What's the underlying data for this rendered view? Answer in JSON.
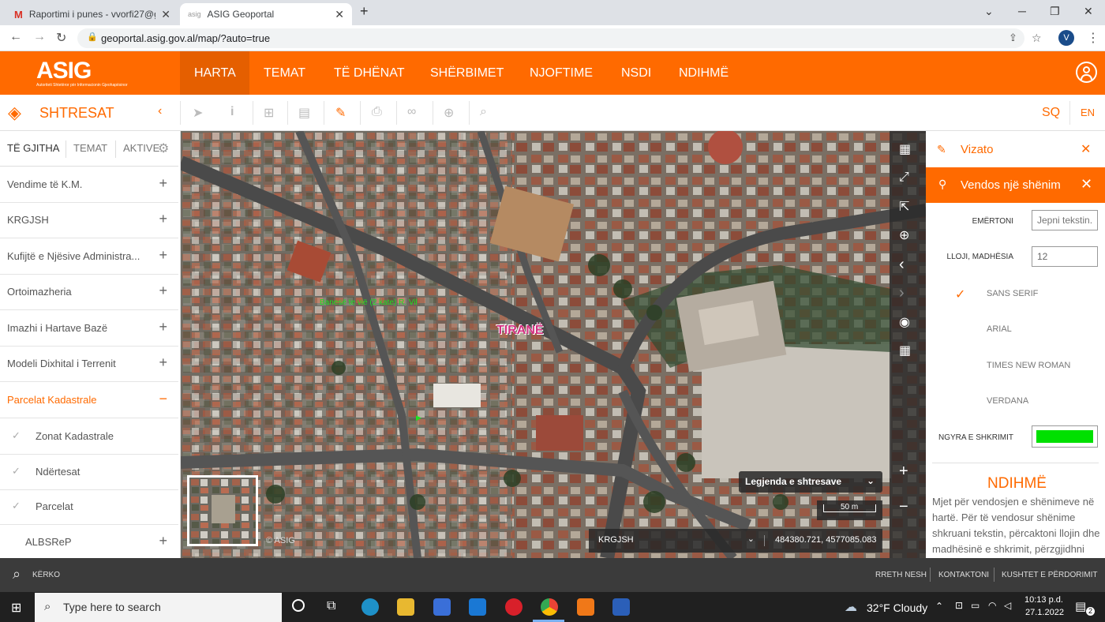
{
  "browser": {
    "tabs": [
      {
        "title": "Raportimi i punes - vvorfi27@gm",
        "active": false
      },
      {
        "title": "ASIG Geoportal",
        "active": true
      }
    ],
    "url": "geoportal.asig.gov.al/map/?auto=true",
    "profile_initial": "V"
  },
  "header": {
    "logo": "ASIG",
    "logo_tagline": "Autoriteti Shtetëror për Informacionin Gjeohapësinor",
    "nav": [
      "HARTA",
      "TEMAT",
      "TË DHËNAT",
      "SHËRBIMET",
      "NJOFTIME",
      "NSDI",
      "NDIHMË"
    ],
    "active_nav": "HARTA"
  },
  "toolbar": {
    "layers_title": "SHTRESAT",
    "languages": [
      "SQ",
      "EN"
    ]
  },
  "sidebar": {
    "tabs": [
      "TË GJITHA",
      "TEMAT",
      "AKTIVE"
    ],
    "items": [
      {
        "label": "Vendime të K.M.",
        "sign": "+"
      },
      {
        "label": "KRGJSH",
        "sign": "+"
      },
      {
        "label": "Kufijtë e Njësive Administra...",
        "sign": "+"
      },
      {
        "label": "Ortoimazheria",
        "sign": "+"
      },
      {
        "label": "Imazhi i Hartave Bazë",
        "sign": "+"
      },
      {
        "label": "Modeli Dixhital i Terrenit",
        "sign": "+"
      },
      {
        "label": "Parcelat Kadastrale",
        "sign": "−",
        "expanded": true
      },
      {
        "label": "Zonat Kadastrale",
        "sub": true
      },
      {
        "label": "Ndërtesat",
        "sub": true
      },
      {
        "label": "Parcelat",
        "sub": true
      },
      {
        "label": "ALBSReP",
        "sign": "+"
      }
    ]
  },
  "map": {
    "city_label": "TIRANË",
    "green_annotation": "Banesë te vië (2 kate) R. Vil",
    "legend_dropdown": "Legjenda e shtresave",
    "scale": "50 m",
    "crs": "KRGJSH",
    "coordinates": "484380.721, 4577085.083",
    "copyright": "© ASIG"
  },
  "panel": {
    "title": "Vizato",
    "subtitle": "Vendos një shënim",
    "label_field": "EMËRTONI",
    "label_placeholder": "Jepni tekstin...",
    "size_field": "LLOJI, MADHËSIA",
    "size_value": "12",
    "fonts": [
      "SANS SERIF",
      "ARIAL",
      "TIMES NEW ROMAN",
      "VERDANA"
    ],
    "selected_font": "SANS SERIF",
    "color_field": "NGYRA E SHKRIMIT",
    "color_value": "#00e000",
    "help_title": "NDIHMË",
    "help_text": "Mjet për vendosjen e shënimeve në hartë. Për të vendosur shënime shkruani tekstin, përcaktoni llojin dhe madhësinë e shkrimit, përzgjidhni"
  },
  "footer": {
    "search": "KËRKO",
    "links": [
      "RRETH NESH",
      "KONTAKTONI",
      "KUSHTET E PËRDORIMIT"
    ]
  },
  "taskbar": {
    "search_placeholder": "Type here to search",
    "weather": "32°F  Cloudy",
    "time": "10:13 p.d.",
    "date": "27.1.2022",
    "notifications": "2"
  },
  "colors": {
    "accent": "#ff6a00",
    "nav_active": "#e55f00",
    "footer": "#3b3b3b"
  }
}
